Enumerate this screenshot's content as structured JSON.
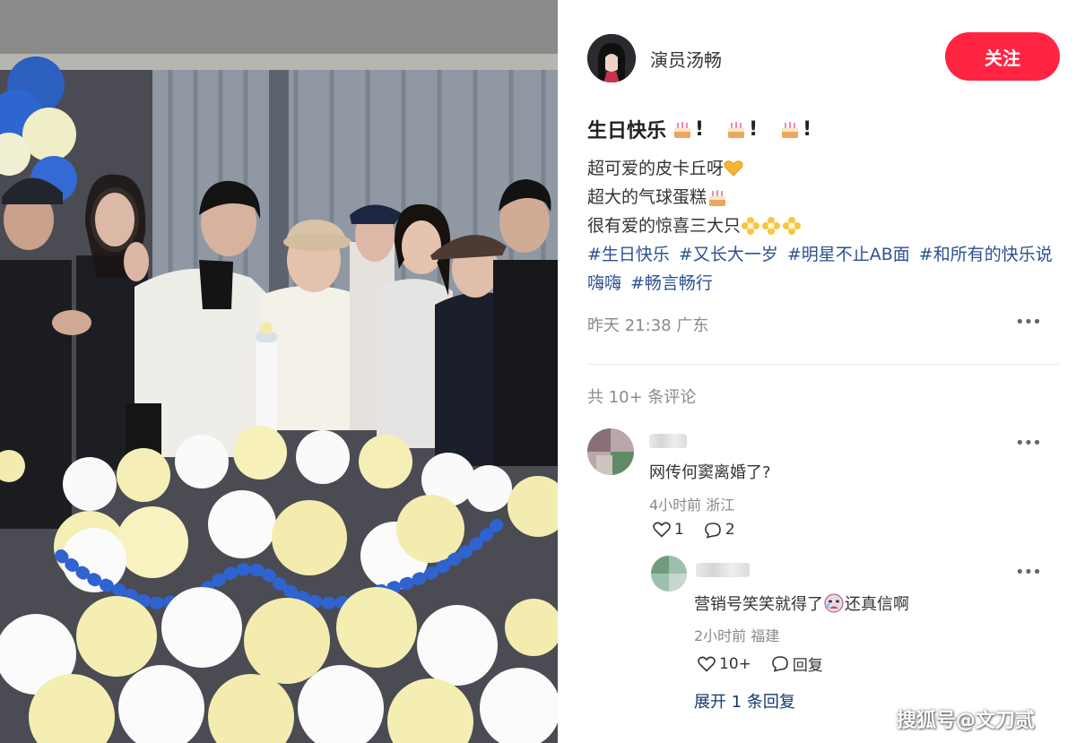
{
  "author": {
    "name": "演员汤畅"
  },
  "follow_label": "关注",
  "post": {
    "title_parts": [
      "生日快乐",
      "!",
      "!",
      "!"
    ],
    "lines": [
      "超可爱的皮卡丘呀",
      "超大的气球蛋糕",
      "很有爱的惊喜三大只"
    ],
    "hashtags": [
      "#生日快乐",
      "#又长大一岁",
      "#明星不止AB面",
      "#和所有的快乐说嗨嗨",
      "#畅言畅行"
    ],
    "time": "昨天 21:38",
    "location": "广东"
  },
  "comments_count": "共 10+ 条评论",
  "comments": [
    {
      "text": "网传何窦离婚了?",
      "time": "4小时前",
      "location": "浙江",
      "likes": "1",
      "replies": "2"
    }
  ],
  "reply": {
    "text_before": "营销号笑笑就得了",
    "text_after": "还真信啊",
    "time": "2小时前",
    "location": "福建",
    "likes": "10+",
    "reply_label": "回复"
  },
  "expand_label": "展开 1 条回复",
  "watermark": "搜狐号@文刀贰",
  "icons": {
    "more": "more-dots-icon",
    "heart": "heart-icon",
    "comment": "comment-bubble-icon",
    "cake": "cake-emoji-icon",
    "heart_emoji": "yellow-heart-emoji-icon",
    "flower": "flower-emoji-icon",
    "crying_face": "crying-face-emoji-icon"
  },
  "colors": {
    "accent": "#ff2442",
    "link": "#13386c",
    "meta": "#8a8a8a"
  }
}
